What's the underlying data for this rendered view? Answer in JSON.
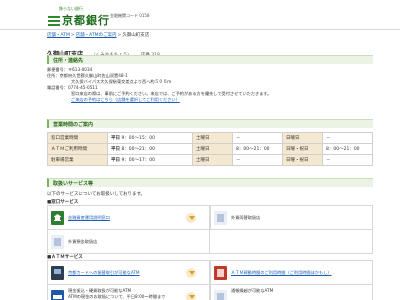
{
  "header": {
    "tagline": "飾らない銀行",
    "bank_name": "京都銀行",
    "bank_code": "金融機関コード 0158"
  },
  "breadcrumb": {
    "items": [
      "店舗・ATM",
      "店舗・ATMのご案内",
      "久御山町支店"
    ]
  },
  "branch": {
    "name": "久御山町支店",
    "kana": "（くみやまちょう）",
    "number": "店番 318"
  },
  "sections": {
    "address": "住所・連絡先",
    "hours": "営業時間のご案内",
    "services": "取扱いサービス等"
  },
  "address": {
    "postal": "郵便番号：〒613-0034",
    "location_line1": "住所：京都府久世郡久御山町佐山双置48-1",
    "location_line2": "大久保バイパス大久保駅東交差点より西へ約５００ｍ",
    "phone": "電話番号：0774-45-0511",
    "notice1": "窓口来店の際は、事前にご予約ください。来店では、ご予約がある方を優先して受付させていただきます。",
    "notice2": "ご来店の予約はこちら（店舗を選択してご利用ください）"
  },
  "hours": {
    "rows": [
      {
        "label": "窓口営業時間",
        "weekday": "平日",
        "weekday_time": "9：00～15：00",
        "sat": "土曜日",
        "sat_val": "－",
        "sun": "日曜日",
        "sun_val": "－"
      },
      {
        "label": "ＡＴＭご利用時間",
        "weekday": "平日",
        "weekday_time": "8：00～21：00",
        "sat": "土曜日",
        "sat_val": "8：00～21：00",
        "sun": "日曜・祝日",
        "sun_val": "8：00～21：00"
      },
      {
        "label": "駐車場営業",
        "weekday": "平日",
        "weekday_time": "9：00～17：00",
        "sat": "土曜日",
        "sat_val": "－",
        "sun": "日曜・祝日",
        "sun_val": "－"
      }
    ]
  },
  "services": {
    "intro": "以下のサービスについてお取扱いしております。",
    "window_category": "■窓口サービス",
    "atm_category": "■ＡＴＭサービス",
    "window_items": [
      {
        "label": "金融資産運用説明窓口"
      },
      {
        "label": "外貨両替取扱店"
      },
      {
        "label": "外貨預金取扱店"
      }
    ],
    "atm_items": [
      {
        "label": "京都カードへの振替取引が可能なATM"
      },
      {
        "label": "ＡＴＭ稼動時間のご利用時間（ご利用時間ほかもし）"
      },
      {
        "label": "現金振込・硬貨取扱が可能なATM",
        "sub1": "ATMの現金のお取扱について、平日8:00～時間まで",
        "sub2": ""
      },
      {
        "label": "通帳繰越が可能なATM",
        "sub1": "",
        "sub2": ""
      }
    ]
  },
  "colors": {
    "brand_green": "#1a6b1a",
    "section_bg": "#eaf3e4",
    "label_bg": "#f4e9d0",
    "link": "#1a5fb4"
  }
}
